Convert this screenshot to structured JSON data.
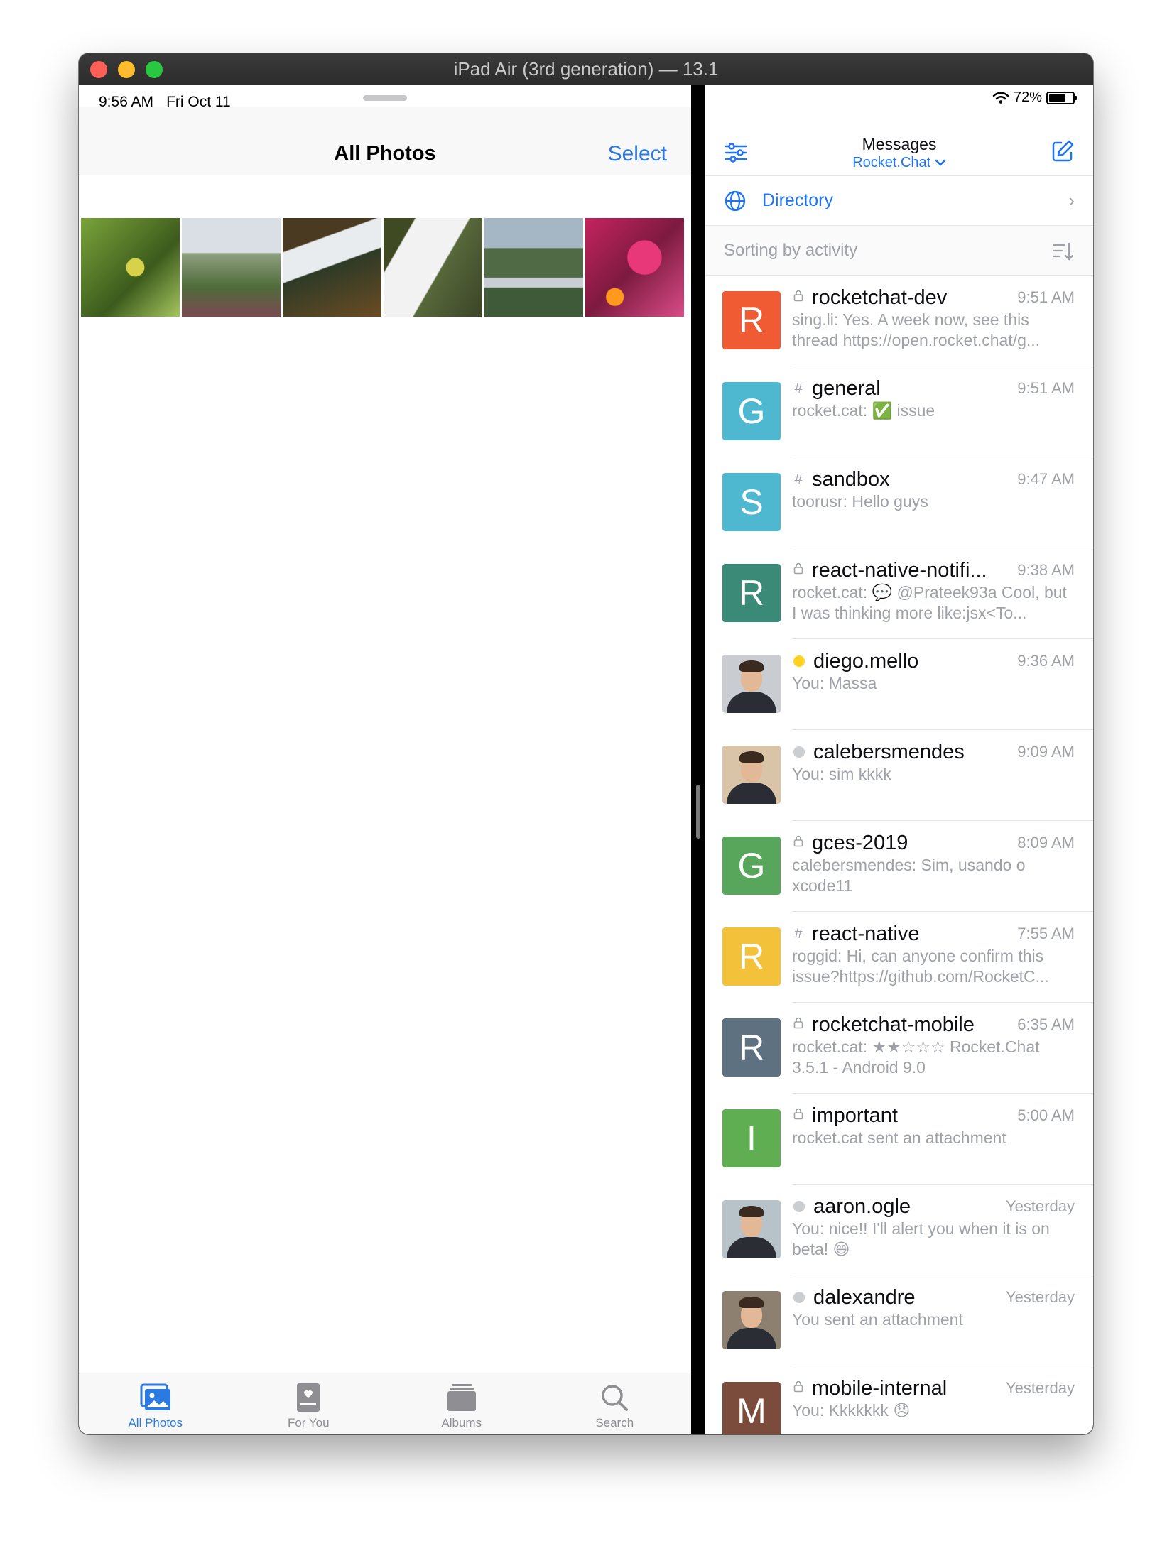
{
  "window": {
    "title": "iPad Air (3rd generation) — 13.1"
  },
  "photos_app": {
    "status_time": "9:56 AM",
    "status_date": "Fri Oct 11",
    "title": "All Photos",
    "select_label": "Select",
    "tabs": [
      {
        "label": "All Photos",
        "icon": "photos-icon",
        "active": true
      },
      {
        "label": "For You",
        "icon": "for-you-icon",
        "active": false
      },
      {
        "label": "Albums",
        "icon": "albums-icon",
        "active": false
      },
      {
        "label": "Search",
        "icon": "search-icon",
        "active": false
      }
    ]
  },
  "chat_app": {
    "status": {
      "battery": "72%"
    },
    "header": {
      "title": "Messages",
      "server": "Rocket.Chat"
    },
    "directory_label": "Directory",
    "sort_label": "Sorting by activity",
    "rooms": [
      {
        "name": "rocketchat-dev",
        "time": "9:51 AM",
        "message": "sing.li: Yes. A week now, see this thread  https://open.rocket.chat/g...",
        "type": "private",
        "avatar_letter": "R",
        "avatar_color": "#f05b33"
      },
      {
        "name": "general",
        "time": "9:51 AM",
        "message": "rocket.cat: ✅ issue",
        "type": "channel",
        "avatar_letter": "G",
        "avatar_color": "#4eb8d0"
      },
      {
        "name": "sandbox",
        "time": "9:47 AM",
        "message": "toorusr: Hello guys",
        "type": "channel",
        "avatar_letter": "S",
        "avatar_color": "#4eb8d0"
      },
      {
        "name": "react-native-notifi...",
        "time": "9:38 AM",
        "message": "rocket.cat: 💬 @Prateek93a Cool, but I was thinking more like:jsx<To...",
        "type": "private",
        "avatar_letter": "R",
        "avatar_color": "#3b8a78"
      },
      {
        "name": "diego.mello",
        "time": "9:36 AM",
        "message": "You: Massa",
        "type": "dm",
        "presence": "away",
        "avatar_letter": "",
        "avatar_color": "#c9cdd2"
      },
      {
        "name": "calebersmendes",
        "time": "9:09 AM",
        "message": "You: sim kkkk",
        "type": "dm",
        "presence": "offline",
        "avatar_letter": "",
        "avatar_color": "#d9c4a8"
      },
      {
        "name": "gces-2019",
        "time": "8:09 AM",
        "message": "calebersmendes: Sim, usando o xcode11",
        "type": "private",
        "avatar_letter": "G",
        "avatar_color": "#58a55c"
      },
      {
        "name": "react-native",
        "time": "7:55 AM",
        "message": "roggid: Hi, can anyone confirm this issue?https://github.com/RocketC...",
        "type": "channel",
        "avatar_letter": "R",
        "avatar_color": "#f4c13b"
      },
      {
        "name": "rocketchat-mobile",
        "time": "6:35 AM",
        "message": "rocket.cat: ★★☆☆☆ Rocket.Chat 3.5.1 - Android 9.0",
        "type": "private",
        "avatar_letter": "R",
        "avatar_color": "#5d7180"
      },
      {
        "name": "important",
        "time": "5:00 AM",
        "message": "rocket.cat sent an attachment",
        "type": "private",
        "avatar_letter": "I",
        "avatar_color": "#5fae52"
      },
      {
        "name": "aaron.ogle",
        "time": "Yesterday",
        "message": "You: nice!! I'll alert you when it is on beta! 😄",
        "type": "dm",
        "presence": "offline",
        "avatar_letter": "",
        "avatar_color": "#b7c2c9"
      },
      {
        "name": "dalexandre",
        "time": "Yesterday",
        "message": "You sent an attachment",
        "type": "dm",
        "presence": "offline",
        "avatar_letter": "",
        "avatar_color": "#8e8070"
      },
      {
        "name": "mobile-internal",
        "time": "Yesterday",
        "message": "You: Kkkkkkk 😞",
        "type": "private",
        "avatar_letter": "M",
        "avatar_color": "#7b4c3b"
      }
    ]
  }
}
